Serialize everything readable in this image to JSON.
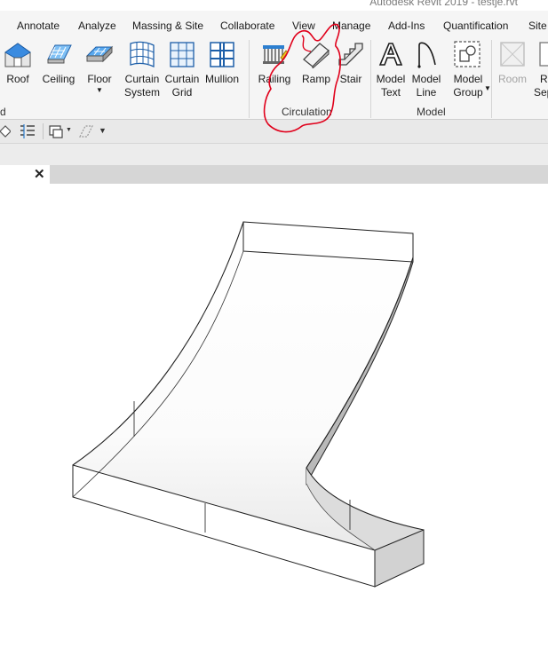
{
  "window": {
    "title": "Autodesk Revit 2019 - testje.rvt"
  },
  "ribbon_tabs": [
    {
      "label": "Annotate"
    },
    {
      "label": "Analyze"
    },
    {
      "label": "Massing & Site"
    },
    {
      "label": "Collaborate"
    },
    {
      "label": "View"
    },
    {
      "label": "Manage"
    },
    {
      "label": "Add-Ins"
    },
    {
      "label": "Quantification"
    },
    {
      "label": "Site"
    }
  ],
  "tools": {
    "roof": {
      "label": "Roof"
    },
    "ceiling": {
      "label": "Ceiling"
    },
    "floor": {
      "label": "Floor"
    },
    "curtain_system": {
      "line1": "Curtain",
      "line2": "System"
    },
    "curtain_grid": {
      "line1": "Curtain",
      "line2": "Grid"
    },
    "mullion": {
      "label": "Mullion"
    },
    "railing": {
      "label": "Railing"
    },
    "ramp": {
      "label": "Ramp"
    },
    "stair": {
      "label": "Stair"
    },
    "model_text": {
      "line1": "Model",
      "line2": "Text"
    },
    "model_line": {
      "line1": "Model",
      "line2": "Line"
    },
    "model_group": {
      "line1": "Model",
      "line2": "Group"
    },
    "room": {
      "label": "Room"
    },
    "room_separator": {
      "line1": "Ro",
      "line2": "Sep"
    }
  },
  "panels": {
    "build_tail": "d",
    "circulation": "Circulation",
    "model": "Model"
  },
  "view": {
    "close_glyph": "✕"
  },
  "colors": {
    "ribbon_bg": "#f5f5f5",
    "icon_blue": "#2c7fd0",
    "annotation_red": "#e0001b"
  }
}
